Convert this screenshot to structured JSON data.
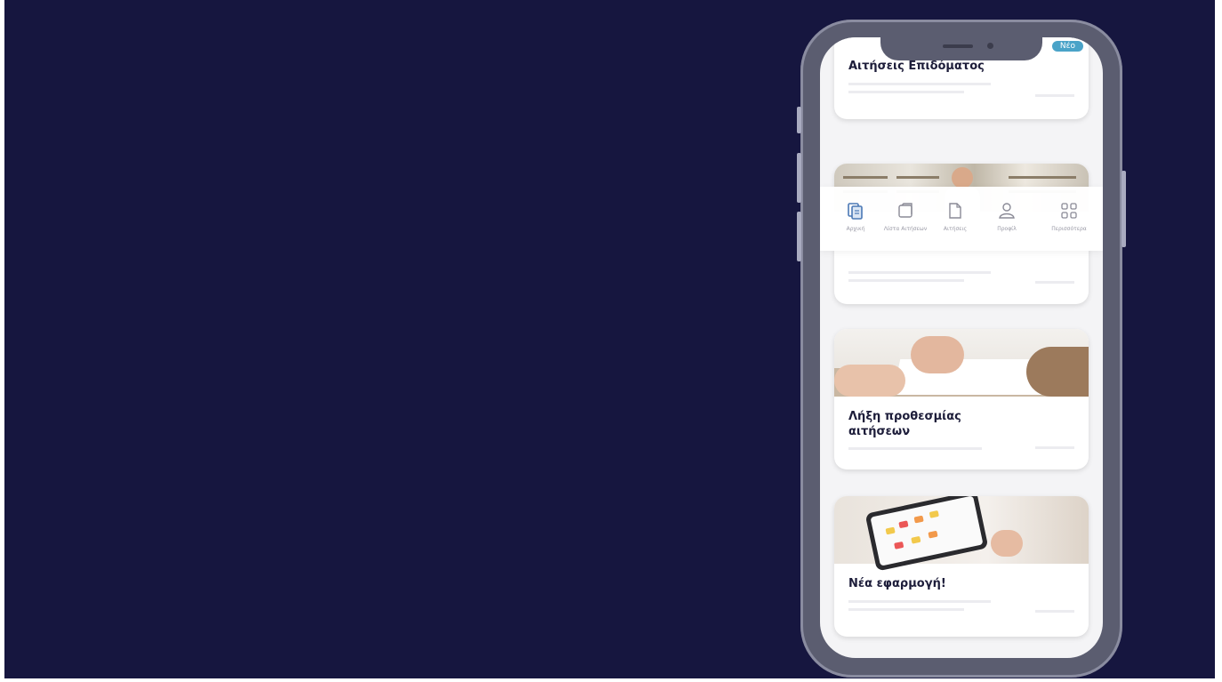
{
  "app": {
    "new_badge": "Νέο",
    "cards": [
      {
        "title": "Αιτήσεις Επιδόματος"
      },
      {
        "title": ""
      },
      {
        "title": "Λήξη προθεσμίας αιτήσεων"
      },
      {
        "title": "Νέα εφαρμογή!"
      }
    ],
    "nav": [
      {
        "label": "Αρχική",
        "icon": "document-stack-icon"
      },
      {
        "label": "Λίστα Αιτήσεων",
        "icon": "folder-icon"
      },
      {
        "label": "Αιτήσεις",
        "icon": "document-icon"
      },
      {
        "label": "Προφίλ",
        "icon": "person-icon"
      },
      {
        "label": "Περισσότερα",
        "icon": "grid-icon"
      }
    ]
  },
  "colors": {
    "background": "#16163f",
    "phone_frame": "#5b5d70",
    "accent": "#4aa3c8",
    "title_text": "#1d1d3a"
  }
}
